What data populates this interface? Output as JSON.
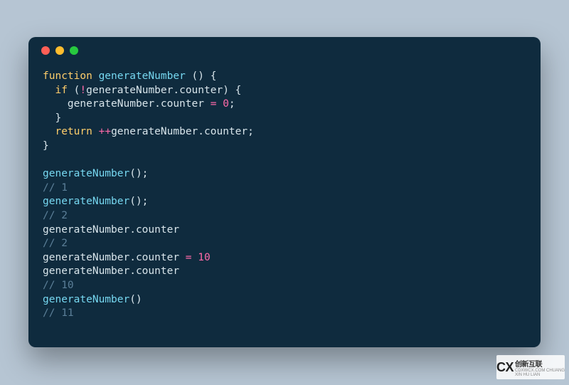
{
  "window": {
    "dots": [
      "red",
      "yellow",
      "green"
    ]
  },
  "code": {
    "l1": {
      "kw": "function",
      "sp1": " ",
      "fn": "generateNumber",
      "sp2": " ",
      "pn1": "()",
      "sp3": " ",
      "pn2": "{"
    },
    "l2": {
      "ind": "  ",
      "kw": "if",
      "sp": " ",
      "pn1": "(",
      "op": "!",
      "id": "generateNumber.counter",
      "pn2": ")",
      "sp2": " ",
      "pn3": "{"
    },
    "l3": {
      "ind": "    ",
      "id": "generateNumber.counter ",
      "op": "=",
      "sp": " ",
      "num": "0",
      "pn": ";"
    },
    "l4": {
      "ind": "  ",
      "pn": "}"
    },
    "l5": {
      "ind": "  ",
      "kw": "return",
      "sp": " ",
      "op": "++",
      "id": "generateNumber.counter",
      "pn": ";"
    },
    "l6": {
      "pn": "}"
    },
    "l7": {
      "blank": ""
    },
    "l8": {
      "fn": "generateNumber",
      "pn": "();"
    },
    "l9": {
      "cm": "// 1"
    },
    "l10": {
      "fn": "generateNumber",
      "pn": "();"
    },
    "l11": {
      "cm": "// 2"
    },
    "l12": {
      "id": "generateNumber.counter"
    },
    "l13": {
      "cm": "// 2"
    },
    "l14": {
      "id": "generateNumber.counter ",
      "op": "=",
      "sp": " ",
      "num": "10"
    },
    "l15": {
      "id": "generateNumber.counter"
    },
    "l16": {
      "cm": "// 10"
    },
    "l17": {
      "fn": "generateNumber",
      "pn": "()"
    },
    "l18": {
      "cm": "// 11"
    }
  },
  "watermark": {
    "logo_big": "CX",
    "text": "创新互联",
    "sub": "CDXWCX.COM CHUANG XIN HU LIAN"
  }
}
